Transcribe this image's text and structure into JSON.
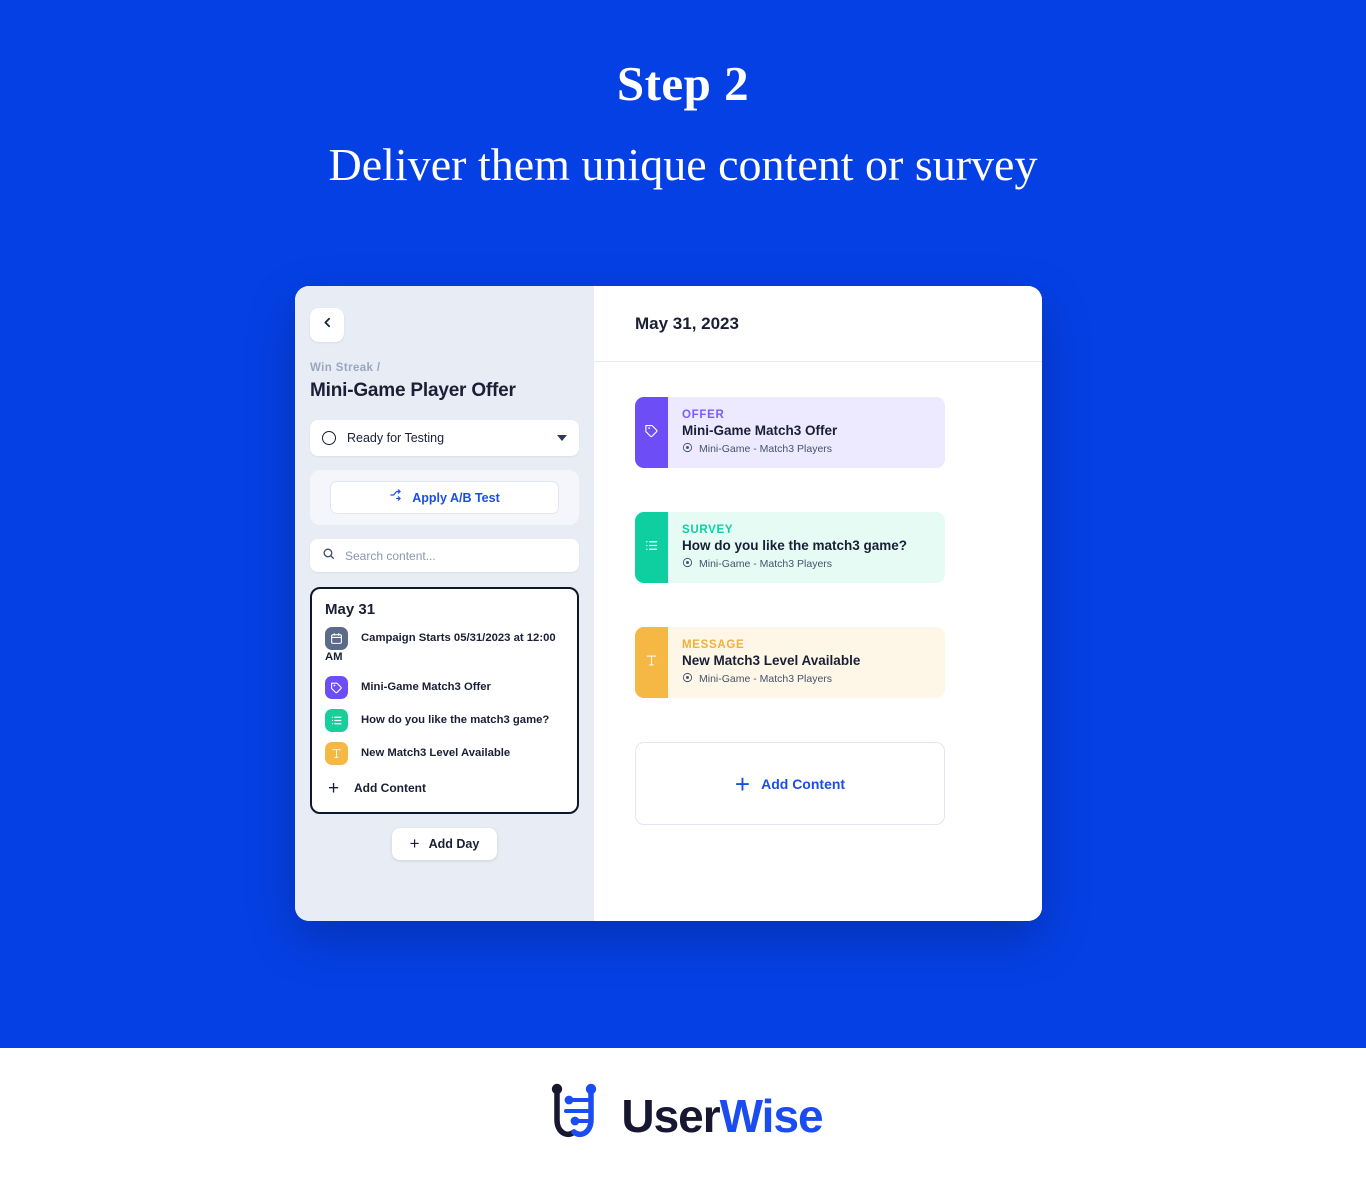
{
  "hero": {
    "title": "Step 2",
    "subtitle": "Deliver them unique content or survey",
    "bg_color": "#0540E5"
  },
  "app": {
    "sidebar": {
      "back_icon": "chevron-left-icon",
      "breadcrumb": "Win Streak /",
      "project_title": "Mini-Game Player Offer",
      "status": {
        "value": "Ready for Testing",
        "icon": "status-circle-icon",
        "caret_icon": "chevron-down-icon"
      },
      "ab_test": {
        "label": "Apply A/B Test",
        "icon": "split-arrow-icon",
        "accent": "#1A4EE8"
      },
      "search": {
        "placeholder": "Search content...",
        "value": "",
        "icon": "search-icon"
      },
      "day_card": {
        "title": "May 31",
        "items": [
          {
            "icon": "calendar-icon",
            "icon_color": "#5C6B8A",
            "label": "Campaign Starts 05/31/2023 at 12:00 AM"
          },
          {
            "icon": "tag-icon",
            "icon_color": "#6C4DF6",
            "label": "Mini-Game Match3 Offer"
          },
          {
            "icon": "list-icon",
            "icon_color": "#18CE9B",
            "label": "How do you like the match3 game?"
          },
          {
            "icon": "text-icon",
            "icon_color": "#F6B845",
            "label": "New Match3 Level Available"
          }
        ],
        "add_label": "Add Content"
      },
      "add_day_label": "Add Day"
    },
    "main": {
      "date_header": "May 31, 2023",
      "cards": [
        {
          "kind": "OFFER",
          "title": "Mini-Game Match3 Offer",
          "meta": "Mini-Game - Match3 Players",
          "meta_icon": "target-icon",
          "stripe_icon": "tag-icon",
          "stripe_color": "#6C4DF6",
          "bg_color": "#EDE9FE",
          "kind_color": "#7C5CFA"
        },
        {
          "kind": "SURVEY",
          "title": "How do you like the match3 game?",
          "meta": "Mini-Game - Match3 Players",
          "meta_icon": "target-icon",
          "stripe_icon": "list-icon",
          "stripe_color": "#0FCFA0",
          "bg_color": "#E6FBF4",
          "kind_color": "#0FCFA0"
        },
        {
          "kind": "MESSAGE",
          "title": "New Match3 Level Available",
          "meta": "Mini-Game - Match3 Players",
          "meta_icon": "target-icon",
          "stripe_icon": "text-icon",
          "stripe_color": "#F6B845",
          "bg_color": "#FEF6E7",
          "kind_color": "#F0B03B"
        }
      ],
      "add_content_label": "Add Content"
    }
  },
  "footer": {
    "logo_mark": "userwise-logo-icon",
    "logo_text_a": "User",
    "logo_text_b": "Wise"
  }
}
